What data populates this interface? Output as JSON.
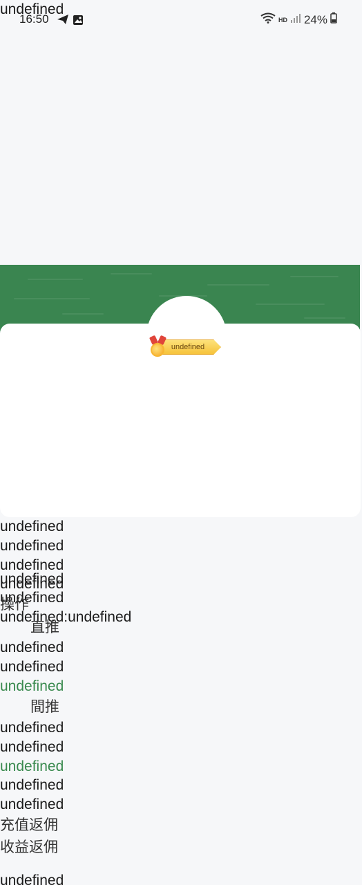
{
  "colors": {
    "banner": "#3a8550",
    "accent_green": "#3a8a4f"
  },
  "top_label": "undefined",
  "status_bar": {
    "time": "16:50",
    "hd": "HD",
    "battery": "24%"
  },
  "badge": {
    "label": "undefined"
  },
  "list": {
    "l1": "undefined",
    "l2": "undefined",
    "l3": "undefined",
    "l4": "undefined",
    "l4b": "undefined",
    "l5": "undefined",
    "action": "操作",
    "l6": "undefined:undefined",
    "direct": "直推",
    "d1": "undefined",
    "d2": "undefined",
    "d3": "undefined",
    "indirect": "間推",
    "i1": "undefined",
    "i2": "undefined",
    "i3": "undefined",
    "e1": "undefined",
    "e2": "undefined",
    "recharge": "充值返佣",
    "income": "收益返佣",
    "last": "undefined"
  }
}
